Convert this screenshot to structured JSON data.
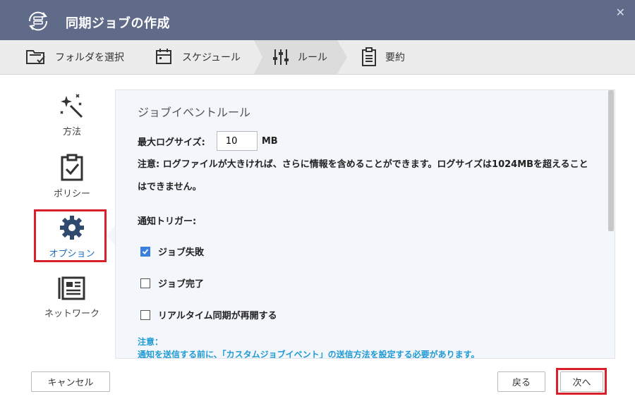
{
  "window": {
    "title": "同期ジョブの作成",
    "close_icon": "close-icon"
  },
  "steps": [
    {
      "label": "フォルダを選択",
      "icon": "folder-check-icon"
    },
    {
      "label": "スケジュール",
      "icon": "calendar-icon"
    },
    {
      "label": "ルール",
      "icon": "sliders-icon",
      "active": true
    },
    {
      "label": "要約",
      "icon": "clipboard-list-icon"
    }
  ],
  "sidebar": {
    "items": [
      {
        "label": "方法",
        "icon": "magic-wand-icon"
      },
      {
        "label": "ポリシー",
        "icon": "clipboard-check-icon"
      },
      {
        "label": "オプション",
        "icon": "gear-icon",
        "active": true
      },
      {
        "label": "ネットワーク",
        "icon": "network-icon"
      }
    ]
  },
  "main": {
    "section_title": "ジョブイベントルール",
    "log_label": "最大ログサイズ:",
    "log_value": "10",
    "log_unit": "MB",
    "note": "注意: ログファイルが大きければ、さらに情報を含めることができます。ログサイズは1024MBを超えることはできません。",
    "trigger_label": "通知トリガー:",
    "triggers": [
      {
        "label": "ジョブ失敗",
        "checked": true
      },
      {
        "label": "ジョブ完了",
        "checked": false
      },
      {
        "label": "リアルタイム同期が再開する",
        "checked": false
      }
    ],
    "bottom_note_title": "注意：",
    "bottom_note_text": "通知を送信する前に、「カスタムジョブイベント」の送信方法を設定する必要があります。"
  },
  "footer": {
    "cancel": "キャンセル",
    "back": "戻る",
    "next": "次へ"
  },
  "colors": {
    "titlebar": "#5f6b88",
    "accent": "#3b7fe0",
    "highlight": "#d9202a",
    "note": "#1f9ad6"
  }
}
